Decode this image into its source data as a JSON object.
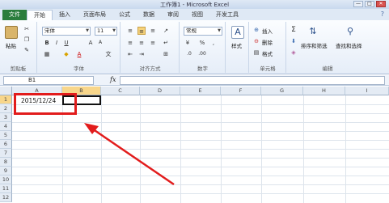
{
  "window": {
    "title": "工作簿1 - Microsoft Excel",
    "min": "—",
    "max": "□",
    "close": "✕"
  },
  "tabs": {
    "file": "文件",
    "items": [
      "开始",
      "插入",
      "页面布局",
      "公式",
      "数据",
      "审阅",
      "视图",
      "开发工具"
    ],
    "active_index": 0,
    "help": "? "
  },
  "ribbon": {
    "clipboard": {
      "paste": "粘贴",
      "label": "剪贴板"
    },
    "font": {
      "name": "宋体",
      "size": "11",
      "label": "字体",
      "bold": "B",
      "italic": "I",
      "underline": "U"
    },
    "alignment": {
      "label": "对齐方式"
    },
    "number": {
      "format": "常规",
      "label": "数字",
      "percent": "%",
      "comma": ","
    },
    "styles": {
      "label": "样式"
    },
    "cells": {
      "insert": "插入",
      "delete": "删除",
      "format": "格式",
      "label": "单元格"
    },
    "editing": {
      "sum": "Σ",
      "sort_filter": "排序和筛选",
      "find_select": "查找和选择",
      "label": "编辑"
    }
  },
  "formula_bar": {
    "name_box": "B1",
    "fx": "fx",
    "content": ""
  },
  "sheet": {
    "columns": [
      "A",
      "B",
      "C",
      "D",
      "E",
      "F",
      "G",
      "H",
      "I"
    ],
    "rows": [
      "1",
      "2",
      "3",
      "4",
      "5",
      "6",
      "7",
      "8",
      "9",
      "10",
      "11",
      "12"
    ],
    "cell_a1": "2015/12/24",
    "selected_column": "B",
    "selected_row": "1"
  },
  "colors": {
    "file_tab": "#2a7d3c",
    "annotation": "#e21c1c",
    "header_selected": "#f8d68a"
  }
}
